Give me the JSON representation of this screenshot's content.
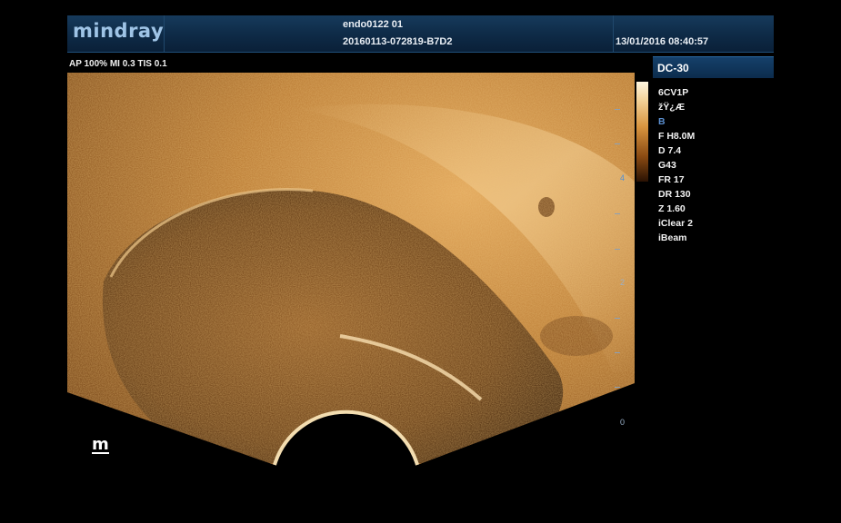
{
  "header": {
    "brand": "mindray",
    "patient_id": "endo0122 01",
    "exam_id": "20160113-072819-B7D2",
    "datetime": "13/01/2016 08:40:57"
  },
  "acoustic_output": "AP 100%  MI 0.3  TIS 0.1",
  "mode_tab": "DC-30",
  "parameters": [
    "6CV1P",
    "žŸ¿Æ",
    "B",
    "F H8.0M",
    "D 7.4",
    "G43",
    "FR 17",
    "DR 130",
    "Z 1.60",
    "iClear 2",
    "iBeam"
  ],
  "depth_marks": [
    "4",
    "2",
    "0"
  ],
  "badge": "m",
  "colors": {
    "header_bg": "#0e2a46",
    "brand": "#9fc4e6",
    "image_tint": "#c98a3e",
    "mode_b": "#5b8fd0"
  }
}
